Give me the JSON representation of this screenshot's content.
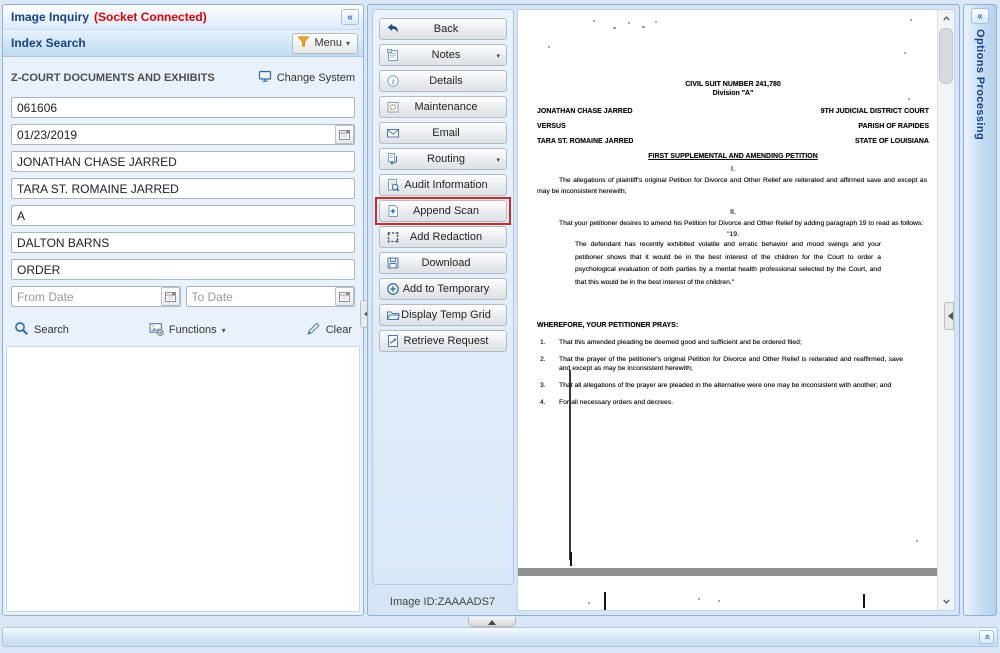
{
  "icons": {
    "collapse": "«",
    "menu_caret": "▼",
    "dropdown_caret": "▼"
  },
  "left_panel": {
    "title": "Image Inquiry",
    "status": "(Socket Connected)",
    "section_title": "Index Search",
    "menu_label": "Menu",
    "system_label": "Z-COURT DOCUMENTS AND EXHIBITS",
    "change_system_label": "Change System",
    "fields": [
      {
        "value": "061606"
      },
      {
        "value": "01/23/2019",
        "calendar": true
      },
      {
        "value": "JONATHAN CHASE JARRED"
      },
      {
        "value": "TARA ST. ROMAINE JARRED"
      },
      {
        "value": "A"
      },
      {
        "value": "DALTON BARNS"
      },
      {
        "value": "ORDER"
      }
    ],
    "from_date_placeholder": "From Date",
    "to_date_placeholder": "To Date",
    "search_label": "Search",
    "functions_label": "Functions",
    "clear_label": "Clear"
  },
  "toolbar": {
    "buttons": [
      {
        "label": "Back"
      },
      {
        "label": "Notes",
        "dropdown": true
      },
      {
        "label": "Details"
      },
      {
        "label": "Maintenance"
      },
      {
        "label": "Email"
      },
      {
        "label": "Routing",
        "dropdown": true
      },
      {
        "label": "Audit Information"
      },
      {
        "label": "Append Scan",
        "highlighted": true
      },
      {
        "label": "Add Redaction"
      },
      {
        "label": "Download"
      },
      {
        "label": "Add to Temporary"
      },
      {
        "label": "Display Temp Grid"
      },
      {
        "label": "Retrieve Request"
      }
    ],
    "image_id_label": "Image ID:ZAAAADS7"
  },
  "document": {
    "case_number": "CIVIL SUIT NUMBER 241,780",
    "division": "Division \"A\"",
    "plaintiff": "JONATHAN CHASE JARRED",
    "versus": "VERSUS",
    "defendant": "TARA ST. ROMAINE JARRED",
    "court": "9TH JUDICIAL DISTRICT COURT",
    "parish": "PARISH OF RAPIDES",
    "state": "STATE OF LOUISIANA",
    "doc_title": "FIRST SUPPLEMENTAL AND AMENDING PETITION",
    "section1_num": "I.",
    "section1_text": "The allegations of plaintiff's original Petition for Divorce and Other Relief are reiterated and affirmed save and except as may be inconsistent herewith;",
    "section2_num": "II.",
    "section2_text": "That your petitioner desires to amend his Petition for Divorce and Other Relief by adding paragraph 19 to read as follows:",
    "quote_open": "\"19.",
    "quote_text": "The defendant has recently exhibited volatile and erratic behavior and mood swings and your petitioner shows that it would be in the best interest of the children for the Court to order a psychological evaluation of both parties by a  mental health professional selected by the Court, and that this would be in the best interest of the children.\"",
    "prayer_heading": "WHEREFORE, YOUR PETITIONER PRAYS:",
    "prayer_items": [
      {
        "num": "1.",
        "text": "That this amended pleading be deemed good and sufficient and be ordered filed;"
      },
      {
        "num": "2.",
        "text": "That the prayer of the petitioner's original Petition for Divorce and Other Relief is reiterated and reaffirmed, save and except as may be inconsistent herewith;"
      },
      {
        "num": "3.",
        "text": "That all allegations of the prayer are pleaded in the alternative were one may be inconsistent with another; and"
      },
      {
        "num": "4.",
        "text": "For all necessary orders and decrees."
      }
    ]
  },
  "right_panel": {
    "title": "Options Processing"
  },
  "colors": {
    "accent_blue": "#15428b",
    "status_red": "#e00000",
    "highlight_red": "#e02222",
    "panel_blue": "#d9e7f6"
  }
}
